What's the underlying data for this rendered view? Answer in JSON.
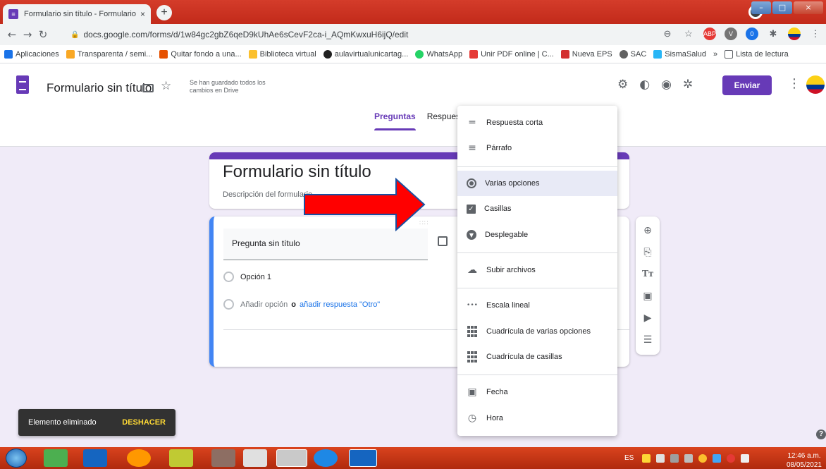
{
  "browser": {
    "tab_title": "Formulario sin título - Formulario",
    "tab_close": "×",
    "new_tab": "+",
    "url": "docs.google.com/forms/d/1w84gc2gbZ6qeD9kUhAe6sCevF2ca-i_AQmKwxuH6ijQ/edit",
    "bookmarks": [
      {
        "label": "Aplicaciones",
        "color": "#1a73e8"
      },
      {
        "label": "Transparenta / semi...",
        "color": "#f9a825"
      },
      {
        "label": "Quitar fondo a una...",
        "color": "#e65100"
      },
      {
        "label": "Biblioteca virtual",
        "color": "#fbc02d"
      },
      {
        "label": "aulavirtualunicartag...",
        "color": "#212121"
      },
      {
        "label": "WhatsApp",
        "color": "#25d366"
      },
      {
        "label": "Unir PDF online | C...",
        "color": "#e53935"
      },
      {
        "label": "Nueva EPS",
        "color": "#d32f2f"
      },
      {
        "label": "SAC",
        "color": "#616161"
      },
      {
        "label": "SismaSalud",
        "color": "#29b6f6"
      }
    ],
    "bookmarks_more": "»",
    "reading_list": "Lista de lectura"
  },
  "forms": {
    "doc_title": "Formulario sin título",
    "saved_note": "Se han guardado todos los cambios en Drive",
    "send_label": "Enviar",
    "tabs": [
      "Preguntas",
      "Respuesta"
    ],
    "accent": "#673ab7"
  },
  "title_card": {
    "title": "Formulario sin título",
    "description": "Descripción del formulario"
  },
  "question": {
    "title": "Pregunta sin título",
    "option1": "Opción 1",
    "add_option": "Añadir opción",
    "or": "o",
    "add_other": "añadir respuesta \"Otro\""
  },
  "menu": {
    "items": [
      {
        "label": "Respuesta corta",
        "icon": "short-answer-icon"
      },
      {
        "label": "Párrafo",
        "icon": "paragraph-icon"
      },
      {
        "label": "Varias opciones",
        "icon": "radio-button-icon"
      },
      {
        "label": "Casillas",
        "icon": "checkbox-icon"
      },
      {
        "label": "Desplegable",
        "icon": "dropdown-icon"
      },
      {
        "label": "Subir archivos",
        "icon": "cloud-upload-icon"
      },
      {
        "label": "Escala lineal",
        "icon": "linear-scale-icon"
      },
      {
        "label": "Cuadrícula de varias opciones",
        "icon": "grid-icon"
      },
      {
        "label": "Cuadrícula de casillas",
        "icon": "grid-icon"
      },
      {
        "label": "Fecha",
        "icon": "calendar-icon"
      },
      {
        "label": "Hora",
        "icon": "clock-icon"
      }
    ],
    "selected": "Varias opciones"
  },
  "snackbar": {
    "message": "Elemento eliminado",
    "action": "DESHACER"
  },
  "taskbar": {
    "lang": "ES",
    "time": "12:46 a.m.",
    "date": "08/05/2021"
  }
}
